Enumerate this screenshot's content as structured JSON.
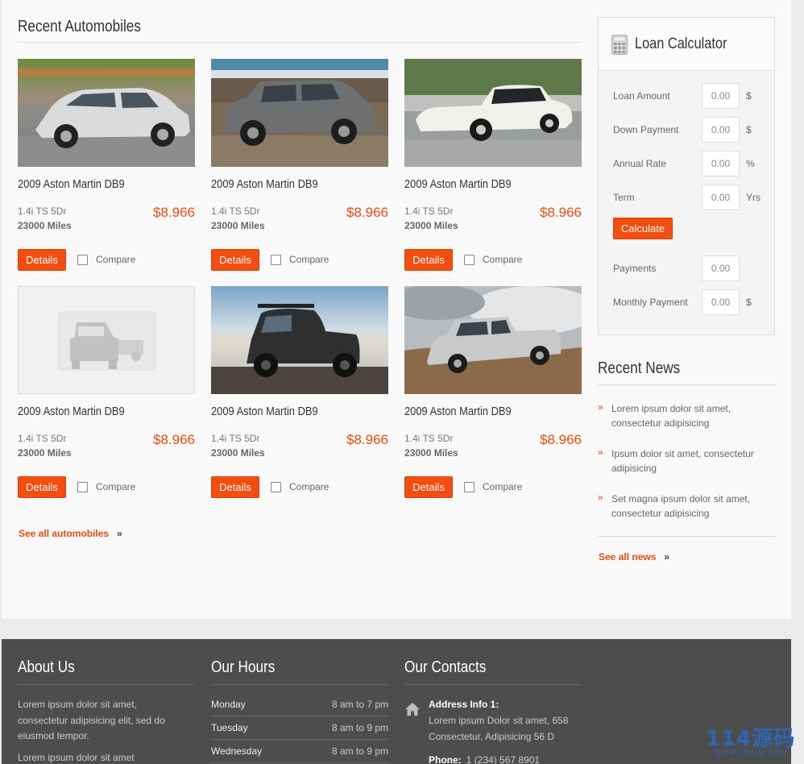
{
  "recent_automobiles": {
    "title": "Recent Automobiles",
    "see_all": "See all automobiles",
    "cars": [
      {
        "name": "2009 Aston Martin DB9",
        "trim": "1.4i TS 5Dr",
        "miles": "23000 Miles",
        "price": "$8.966",
        "details": "Details",
        "compare": "Compare",
        "image": "silver-hatchback"
      },
      {
        "name": "2009 Aston Martin DB9",
        "trim": "1.4i TS 5Dr",
        "miles": "23000 Miles",
        "price": "$8.966",
        "details": "Details",
        "compare": "Compare",
        "image": "grey-suv-beach"
      },
      {
        "name": "2009 Aston Martin DB9",
        "trim": "1.4i TS 5Dr",
        "miles": "23000 Miles",
        "price": "$8.966",
        "details": "Details",
        "compare": "Compare",
        "image": "white-classic-coupe"
      },
      {
        "name": "2009 Aston Martin DB9",
        "trim": "1.4i TS 5Dr",
        "miles": "23000 Miles",
        "price": "$8.966",
        "details": "Details",
        "compare": "Compare",
        "image": "placeholder-cars"
      },
      {
        "name": "2009 Aston Martin DB9",
        "trim": "1.4i TS 5Dr",
        "miles": "23000 Miles",
        "price": "$8.966",
        "details": "Details",
        "compare": "Compare",
        "image": "dark-suv-snow"
      },
      {
        "name": "2009 Aston Martin DB9",
        "trim": "1.4i TS 5Dr",
        "miles": "23000 Miles",
        "price": "$8.966",
        "details": "Details",
        "compare": "Compare",
        "image": "silver-pickup-offroad"
      }
    ]
  },
  "loan_calculator": {
    "title": "Loan Calculator",
    "icon": "calculator-icon",
    "rows": [
      {
        "label": "Loan Amount",
        "value": "0.00",
        "unit": "$"
      },
      {
        "label": "Down Payment",
        "value": "0.00",
        "unit": "$"
      },
      {
        "label": "Annual Rate",
        "value": "0.00",
        "unit": "%"
      },
      {
        "label": "Term",
        "value": "0.00",
        "unit": "Yrs"
      }
    ],
    "calculate": "Calculate",
    "results": [
      {
        "label": "Payments",
        "value": "0.00",
        "unit": ""
      },
      {
        "label": "Monthly Payment",
        "value": "0.00",
        "unit": "$"
      }
    ]
  },
  "recent_news": {
    "title": "Recent News",
    "items": [
      "Lorem ipsum dolor sit amet, consectetur adipisicing",
      "Ipsum dolor sit amet, consectetur adipisicing",
      "Set magna ipsum dolor sit amet, consectetur adipisicing"
    ],
    "see_all": "See all news"
  },
  "footer": {
    "about": {
      "title": "About Us",
      "text": "Lorem ipsum dolor sit amet, consectetur adipisicing elit, sed do eiusmod tempor.",
      "text2": "Lorem ipsum dolor sit amet"
    },
    "hours": {
      "title": "Our Hours",
      "rows": [
        {
          "day": "Monday",
          "time": "8 am to 7 pm"
        },
        {
          "day": "Tuesday",
          "time": "8 am to 9 pm"
        },
        {
          "day": "Wednesday",
          "time": "8 am to 9 pm"
        }
      ]
    },
    "contacts": {
      "title": "Our Contacts",
      "address_label": "Address Info 1:",
      "address": "Lorem ipsum Dolor sit amet, 658 Consectetur, Adipisicing 56 D",
      "phone_label": "Phone:",
      "phone": "1 (234) 567 8901"
    }
  },
  "watermark": {
    "big": "114源码",
    "small": "WWW.114YM.COM"
  },
  "colors": {
    "accent": "#f34d10",
    "footer_bg": "#4d4d4d",
    "page_bg": "#f9f9f9"
  }
}
